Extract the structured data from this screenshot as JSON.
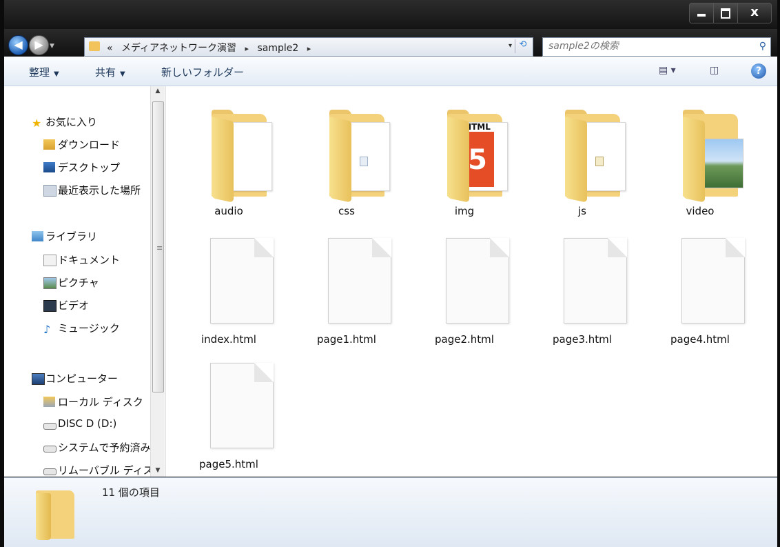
{
  "window": {
    "buttons": {
      "minimize": "minimize-button",
      "maximize": "maximize-button",
      "close": "close-button"
    },
    "close_glyph": "x"
  },
  "address": {
    "chevron": "«",
    "path": [
      "メディアネットワーク演習",
      "sample2"
    ],
    "sep": "▸",
    "dropdown": "▾",
    "refresh": "⟲"
  },
  "search": {
    "placeholder": "sample2の検索",
    "icon": "search-icon"
  },
  "toolbar": {
    "organize": "整理",
    "share": "共有",
    "new_folder": "新しいフォルダー",
    "caret": "▼"
  },
  "nav": {
    "favorites": "お気に入り",
    "downloads": "ダウンロード",
    "desktop": "デスクトップ",
    "recent": "最近表示した場所",
    "libraries": "ライブラリ",
    "documents": "ドキュメント",
    "pictures": "ピクチャ",
    "videos": "ビデオ",
    "music": "ミュージック",
    "computer": "コンピューター",
    "local_disk": "ローカル ディスク",
    "disc_d": "DISC D (D:)",
    "system_reserved": "システムで予約済み",
    "removable": "リムーバブル ディスク"
  },
  "items": {
    "audio": "audio",
    "css": "css",
    "img": "img",
    "js": "js",
    "video": "video",
    "index": "index.html",
    "page1": "page1.html",
    "page2": "page2.html",
    "page3": "page3.html",
    "page4": "page4.html",
    "page5": "page5.html"
  },
  "img_folder_badge": {
    "label": "HTML",
    "number": "5"
  },
  "details": {
    "count": "11 個の項目"
  },
  "colors": {
    "folder": "#f4d27c",
    "accent": "#1e56a8",
    "html5": "#e44d26"
  }
}
